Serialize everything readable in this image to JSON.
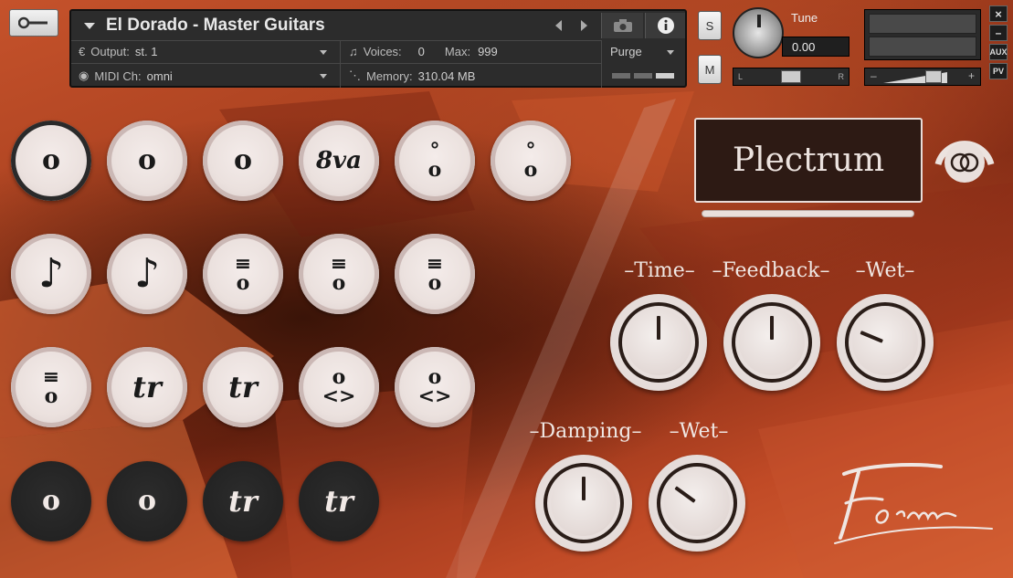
{
  "header": {
    "instrument_name": "El Dorado - Master Guitars",
    "output_label": "Output:",
    "output_value": "st. 1",
    "voices_label": "Voices:",
    "voices_value": "0",
    "max_label": "Max:",
    "max_value": "999",
    "midi_label": "MIDI Ch:",
    "midi_value": "omni",
    "memory_label": "Memory:",
    "memory_value": "310.04 MB",
    "purge_label": "Purge",
    "solo_label": "S",
    "mute_label": "M",
    "tune_label": "Tune",
    "tune_value": "0.00",
    "pan_left": "L",
    "pan_right": "R",
    "vol_minus": "–",
    "vol_plus": "+",
    "close_label": "×",
    "minimize_label": "–",
    "aux_label": "AUX",
    "pv_label": "PV"
  },
  "articulations": [
    {
      "glyph": "o",
      "style": "selected"
    },
    {
      "glyph": "o",
      "style": "light"
    },
    {
      "glyph": "o",
      "style": "light"
    },
    {
      "glyph": "8va",
      "style": "light"
    },
    {
      "glyph": "°\no",
      "style": "light"
    },
    {
      "glyph": "°\no",
      "style": "light"
    },
    {
      "glyph": "♪",
      "style": "light"
    },
    {
      "glyph": "♪",
      "style": "light"
    },
    {
      "glyph": "≡\no",
      "style": "light"
    },
    {
      "glyph": "≡\no",
      "style": "light"
    },
    {
      "glyph": "≡\no",
      "style": "light"
    },
    {
      "glyph": "≡\no",
      "style": "light"
    },
    {
      "glyph": "tr",
      "style": "light"
    },
    {
      "glyph": "tr",
      "style": "light"
    },
    {
      "glyph": "o\n<>",
      "style": "light"
    },
    {
      "glyph": "o\n<>",
      "style": "light"
    },
    {
      "glyph": "o",
      "style": "dark"
    },
    {
      "glyph": "o",
      "style": "dark"
    },
    {
      "glyph": "tr",
      "style": "dark"
    },
    {
      "glyph": "tr",
      "style": "dark"
    }
  ],
  "plectrum": {
    "label": "Plectrum"
  },
  "effects": {
    "time_label": "–Time–",
    "feedback_label": "–Feedback–",
    "wet_label_1": "–Wet–",
    "damping_label": "–Damping–",
    "wet_label_2": "–Wet–",
    "time_value": 0.5,
    "feedback_value": 0.5,
    "wet_value_1": 0.25,
    "damping_value": 0.5,
    "wet_value_2": 0.3
  },
  "colors": {
    "accent": "#e9dfdb",
    "panel_dark": "#2d1a14",
    "background": "#a8401f"
  }
}
